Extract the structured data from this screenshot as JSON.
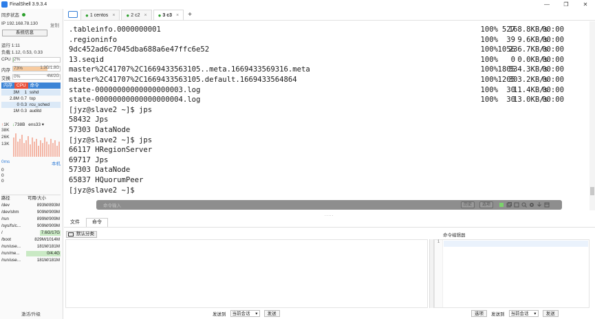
{
  "window": {
    "title": "FinalShell 3.9.3.4",
    "controls": [
      "—",
      "❐",
      "✕"
    ]
  },
  "left_panel": {
    "sync_status": "同步状态",
    "sync_dot_color": "#2ca02c",
    "ip_label": "IP 192.168.78.130",
    "copy_label": "复制",
    "sysinfo_button": "系统信息",
    "uptime": "运行 1:11",
    "load": "负载 1.12, 0.53, 0.33",
    "cpu": {
      "label": "CPU",
      "value": "2%",
      "fraction": 0.02
    },
    "mem": {
      "label": "内存",
      "percent": "73%",
      "value": "1.3G/1.8G",
      "fraction": 0.73
    },
    "swap": {
      "label": "交换",
      "percent": "0%",
      "value": "4M/2G",
      "fraction": 0.0
    },
    "proc_tabs": [
      "内存",
      "CPU",
      "命令"
    ],
    "processes": [
      {
        "mem": "3M",
        "cpu": "1",
        "name": "sshd"
      },
      {
        "mem": "2.8M",
        "cpu": "0.7",
        "name": "top"
      },
      {
        "mem": "0",
        "cpu": "0.3",
        "name": "rcu_sched"
      },
      {
        "mem": "1M",
        "cpu": "0.3",
        "name": "auditd"
      }
    ],
    "net": {
      "up": "1K",
      "down": "738B",
      "iface": "ens33",
      "y_ticks": [
        "38K",
        "26K",
        "13K"
      ]
    },
    "ping": {
      "latency": "0ms",
      "target": "本机",
      "values": [
        "0",
        "0",
        "0"
      ]
    },
    "disk_header": {
      "path": "路径",
      "size": "可用/大小"
    },
    "disks": [
      {
        "path": "/dev",
        "size": "893M/893M",
        "fill": 0
      },
      {
        "path": "/dev/shm",
        "size": "909M/909M",
        "fill": 0
      },
      {
        "path": "/run",
        "size": "899M/909M",
        "fill": 0
      },
      {
        "path": "/sys/fs/c...",
        "size": "909M/909M",
        "fill": 0
      },
      {
        "path": "/",
        "size": "7.6G/17G",
        "fill": 0.55
      },
      {
        "path": "/boot",
        "size": "829M/1014M",
        "fill": 0
      },
      {
        "path": "/run/use...",
        "size": "181M/181M",
        "fill": 0
      },
      {
        "path": "/run/me...",
        "size": "0/4.4G",
        "fill": 1.0
      },
      {
        "path": "/run/use...",
        "size": "181M/181M",
        "fill": 0
      }
    ],
    "upgrade": "激活/升级"
  },
  "tabs": [
    {
      "label": "1 centos",
      "close": "×"
    },
    {
      "label": "2 c2",
      "close": "×"
    },
    {
      "label": "3 c3",
      "close": "×"
    }
  ],
  "tab_add": "+",
  "terminal": {
    "transfers": [
      {
        "name": ".tableinfo.0000000001",
        "pct": "100%",
        "size": "527",
        "rate": "168.8KB/s",
        "time": "00:00"
      },
      {
        "name": ".regioninfo",
        "pct": "100%",
        "size": "39",
        "rate": "9.6KB/s",
        "time": "00:00"
      },
      {
        "name": "9dc452ad6c7045dba688a6e47ffc6e52",
        "pct": "100%",
        "size": "1056",
        "rate": "236.7KB/s",
        "time": "00:00"
      },
      {
        "name": "13.seqid",
        "pct": "100%",
        "size": "0",
        "rate": "0.0KB/s",
        "time": "00:00"
      },
      {
        "name": "master%2C41707%2C1669433563105..meta.1669433569316.meta",
        "pct": "100%",
        "size": "1805",
        "rate": "534.3KB/s",
        "time": "00:00"
      },
      {
        "name": "master%2C41707%2C1669433563105.default.1669433564864",
        "pct": "100%",
        "size": "1205",
        "rate": "303.2KB/s",
        "time": "00:00"
      },
      {
        "name": "state-00000000000000000003.log",
        "pct": "100%",
        "size": "30",
        "rate": "11.4KB/s",
        "time": "00:00"
      },
      {
        "name": "state-00000000000000000004.log",
        "pct": "100%",
        "size": "30",
        "rate": "13.0KB/s",
        "time": "00:00"
      }
    ],
    "lines": [
      "[jyz@slave2 ~]$ jps",
      "58432 Jps",
      "57303 DataNode",
      "[jyz@slave2 ~]$ jps",
      "66117 HRegionServer",
      "69717 Jps",
      "57303 DataNode",
      "65837 HQuorumPeer",
      "[jyz@slave2 ~]$"
    ]
  },
  "cmdbar": {
    "placeholder": "命令输入",
    "history": "历史",
    "options": "选项"
  },
  "bottom_tabs": [
    "文件",
    "命令"
  ],
  "commands": {
    "category": "默认分类",
    "editor_title": "命令编辑器",
    "editor_line": "1",
    "send_to": "发送到",
    "current_session": "当前会话",
    "send": "发送",
    "select": "选项"
  }
}
